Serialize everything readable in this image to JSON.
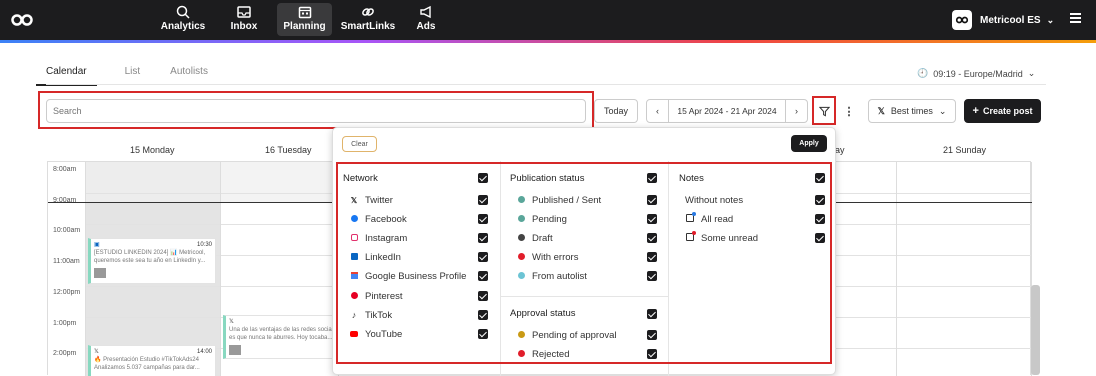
{
  "nav": {
    "items": [
      {
        "label": "Analytics",
        "icon": "analytics-icon"
      },
      {
        "label": "Inbox",
        "icon": "inbox-icon"
      },
      {
        "label": "Planning",
        "icon": "calendar-icon",
        "active": true
      },
      {
        "label": "SmartLinks",
        "icon": "link-icon"
      },
      {
        "label": "Ads",
        "icon": "megaphone-icon"
      }
    ],
    "account": "Metricool ES"
  },
  "tabs": [
    "Calendar",
    "List",
    "Autolists"
  ],
  "timezone": "09:19 - Europe/Madrid",
  "search": {
    "placeholder": "Search"
  },
  "toolbar": {
    "today": "Today",
    "date_range": "15 Apr 2024 - 21 Apr 2024",
    "best_times": "Best times",
    "create_post": "Create post"
  },
  "calendar": {
    "days": [
      {
        "label": "15 Monday"
      },
      {
        "label": "16 Tuesday"
      },
      {
        "label": "day"
      },
      {
        "label": "21 Sunday"
      }
    ],
    "times": [
      "8:00am",
      "9:00am",
      "10:00am",
      "11:00am",
      "12:00pm",
      "1:00pm",
      "2:00pm"
    ],
    "posts": [
      {
        "time": "10:30",
        "lines": [
          "[ESTUDIO LINKEDIN 2024] 📊 Metricool,",
          "queremos este sea tu año en LinkedIn y..."
        ]
      },
      {
        "time": "",
        "lines": [
          "Una de las ventajas de las redes socia",
          "es que nunca te aburres. Hoy tocaba..."
        ]
      },
      {
        "time": "14:00",
        "lines": [
          "🔥 Presentación Estudio #TikTokAds24",
          "Analizamos 5.037 campañas para dar..."
        ]
      }
    ]
  },
  "filter": {
    "clear": "Clear",
    "apply": "Apply",
    "network": {
      "title": "Network",
      "options": [
        {
          "label": "Twitter",
          "icon": "x-twitter-icon",
          "color": "#222222"
        },
        {
          "label": "Facebook",
          "icon": "facebook-icon",
          "color": "#1877f2"
        },
        {
          "label": "Instagram",
          "icon": "instagram-icon",
          "color": "#e1306c"
        },
        {
          "label": "LinkedIn",
          "icon": "linkedin-icon",
          "color": "#0a66c2"
        },
        {
          "label": "Google Business Profile",
          "icon": "google-business-icon",
          "color": "#4285f4"
        },
        {
          "label": "Pinterest",
          "icon": "pinterest-icon",
          "color": "#e60023"
        },
        {
          "label": "TikTok",
          "icon": "tiktok-icon",
          "color": "#000000"
        },
        {
          "label": "YouTube",
          "icon": "youtube-icon",
          "color": "#ff0000"
        }
      ]
    },
    "publication_status": {
      "title": "Publication status",
      "options": [
        {
          "label": "Published / Sent",
          "color": "#5aa69a"
        },
        {
          "label": "Pending",
          "color": "#5aa69a"
        },
        {
          "label": "Draft",
          "color": "#444444"
        },
        {
          "label": "With errors",
          "color": "#e11d2a"
        },
        {
          "label": "From autolist",
          "color": "#6cc4d4"
        }
      ]
    },
    "approval_status": {
      "title": "Approval status",
      "options": [
        {
          "label": "Pending of approval",
          "color": "#c99a14"
        },
        {
          "label": "Rejected",
          "color": "#e11d2a"
        }
      ]
    },
    "notes": {
      "title": "Notes",
      "options": [
        {
          "label": "Without notes",
          "icon": ""
        },
        {
          "label": "All read",
          "icon": "note-read-icon"
        },
        {
          "label": "Some unread",
          "icon": "note-unread-icon"
        }
      ]
    }
  }
}
